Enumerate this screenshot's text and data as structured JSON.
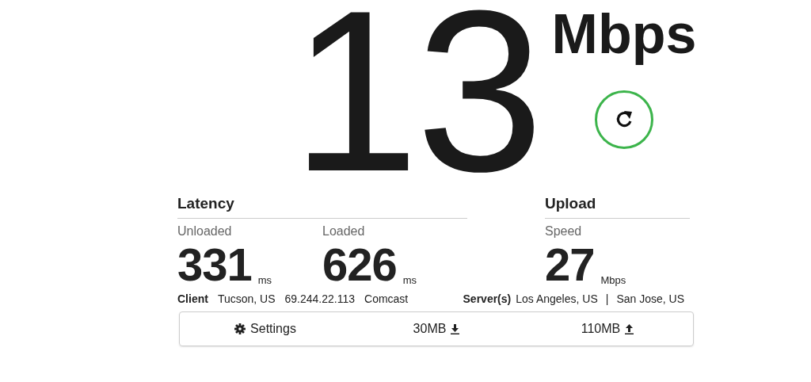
{
  "speed": {
    "value": "13",
    "unit": "Mbps"
  },
  "latency": {
    "heading": "Latency",
    "metrics": [
      {
        "label": "Unloaded",
        "value": "331",
        "unit": "ms"
      },
      {
        "label": "Loaded",
        "value": "626",
        "unit": "ms"
      }
    ]
  },
  "upload": {
    "heading": "Upload",
    "metrics": [
      {
        "label": "Speed",
        "value": "27",
        "unit": "Mbps"
      }
    ]
  },
  "client": {
    "label": "Client",
    "location": "Tucson, US",
    "ip": "69.244.22.113",
    "isp": "Comcast"
  },
  "servers": {
    "label": "Server(s)",
    "items": [
      "Los Angeles, US",
      "San Jose, US"
    ],
    "separator": "|"
  },
  "settings_bar": [
    {
      "kind": "settings",
      "label": "Settings"
    },
    {
      "kind": "download",
      "label": "30MB"
    },
    {
      "kind": "upload",
      "label": "110MB"
    }
  ]
}
